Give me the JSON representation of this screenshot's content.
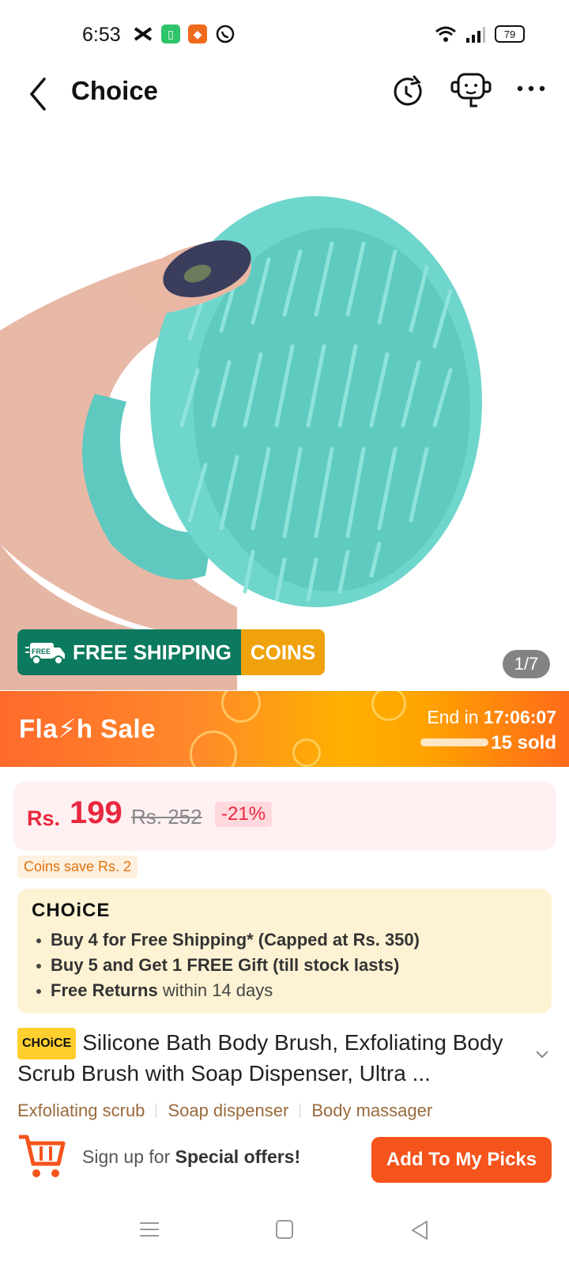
{
  "status_bar": {
    "time": "6:53",
    "battery": "79"
  },
  "header": {
    "title": "Choice"
  },
  "product": {
    "free_shipping_label": "FREE SHIPPING",
    "truck_badge": "FREE",
    "coins_label": "COINS",
    "image_counter": "1/7"
  },
  "flash_sale": {
    "title": "Fla⚡h  Sale",
    "end_label": "End in",
    "end_time": "17:06:07",
    "sold": "15 sold"
  },
  "price": {
    "currency": "Rs.",
    "value": "199",
    "original": "Rs. 252",
    "discount": "-21%"
  },
  "coins_save": "Coins save Rs. 2",
  "choice_box": {
    "logo": "CHOiCE",
    "items": [
      {
        "bold": "Buy 4 for  Free Shipping* (Capped at Rs. 350)",
        "rest": ""
      },
      {
        "bold": "Buy 5 and Get 1 FREE Gift (till stock lasts)",
        "rest": ""
      },
      {
        "bold": "Free Returns",
        "rest": " within 14 days"
      }
    ]
  },
  "title": {
    "chip": "CHOiCE",
    "text": "Silicone Bath Body Brush, Exfoliating Body Scrub Brush with Soap Dispenser, Ultra ..."
  },
  "tags": [
    "Exfoliating scrub",
    "Soap dispenser",
    "Body massager"
  ],
  "bottom_bar": {
    "signup_prefix": "Sign up for ",
    "signup_bold": "Special offers!",
    "add_button": "Add To My Picks"
  },
  "colors": {
    "accent": "#f5541c",
    "price": "#e8283f",
    "shipping": "#0c7a5e",
    "coins": "#f0a20c"
  }
}
